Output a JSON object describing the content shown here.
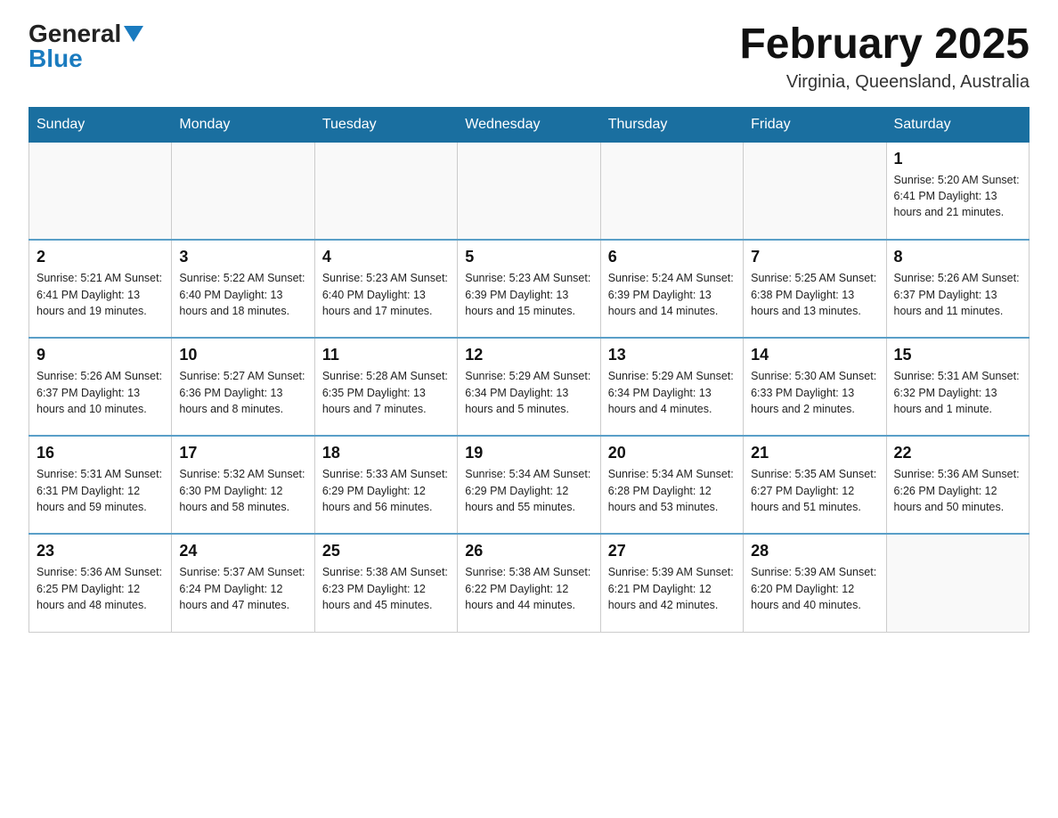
{
  "header": {
    "logo_general": "General",
    "logo_blue": "Blue",
    "month_year": "February 2025",
    "location": "Virginia, Queensland, Australia"
  },
  "weekdays": [
    "Sunday",
    "Monday",
    "Tuesday",
    "Wednesday",
    "Thursday",
    "Friday",
    "Saturday"
  ],
  "weeks": [
    [
      {
        "day": "",
        "info": ""
      },
      {
        "day": "",
        "info": ""
      },
      {
        "day": "",
        "info": ""
      },
      {
        "day": "",
        "info": ""
      },
      {
        "day": "",
        "info": ""
      },
      {
        "day": "",
        "info": ""
      },
      {
        "day": "1",
        "info": "Sunrise: 5:20 AM\nSunset: 6:41 PM\nDaylight: 13 hours and 21 minutes."
      }
    ],
    [
      {
        "day": "2",
        "info": "Sunrise: 5:21 AM\nSunset: 6:41 PM\nDaylight: 13 hours and 19 minutes."
      },
      {
        "day": "3",
        "info": "Sunrise: 5:22 AM\nSunset: 6:40 PM\nDaylight: 13 hours and 18 minutes."
      },
      {
        "day": "4",
        "info": "Sunrise: 5:23 AM\nSunset: 6:40 PM\nDaylight: 13 hours and 17 minutes."
      },
      {
        "day": "5",
        "info": "Sunrise: 5:23 AM\nSunset: 6:39 PM\nDaylight: 13 hours and 15 minutes."
      },
      {
        "day": "6",
        "info": "Sunrise: 5:24 AM\nSunset: 6:39 PM\nDaylight: 13 hours and 14 minutes."
      },
      {
        "day": "7",
        "info": "Sunrise: 5:25 AM\nSunset: 6:38 PM\nDaylight: 13 hours and 13 minutes."
      },
      {
        "day": "8",
        "info": "Sunrise: 5:26 AM\nSunset: 6:37 PM\nDaylight: 13 hours and 11 minutes."
      }
    ],
    [
      {
        "day": "9",
        "info": "Sunrise: 5:26 AM\nSunset: 6:37 PM\nDaylight: 13 hours and 10 minutes."
      },
      {
        "day": "10",
        "info": "Sunrise: 5:27 AM\nSunset: 6:36 PM\nDaylight: 13 hours and 8 minutes."
      },
      {
        "day": "11",
        "info": "Sunrise: 5:28 AM\nSunset: 6:35 PM\nDaylight: 13 hours and 7 minutes."
      },
      {
        "day": "12",
        "info": "Sunrise: 5:29 AM\nSunset: 6:34 PM\nDaylight: 13 hours and 5 minutes."
      },
      {
        "day": "13",
        "info": "Sunrise: 5:29 AM\nSunset: 6:34 PM\nDaylight: 13 hours and 4 minutes."
      },
      {
        "day": "14",
        "info": "Sunrise: 5:30 AM\nSunset: 6:33 PM\nDaylight: 13 hours and 2 minutes."
      },
      {
        "day": "15",
        "info": "Sunrise: 5:31 AM\nSunset: 6:32 PM\nDaylight: 13 hours and 1 minute."
      }
    ],
    [
      {
        "day": "16",
        "info": "Sunrise: 5:31 AM\nSunset: 6:31 PM\nDaylight: 12 hours and 59 minutes."
      },
      {
        "day": "17",
        "info": "Sunrise: 5:32 AM\nSunset: 6:30 PM\nDaylight: 12 hours and 58 minutes."
      },
      {
        "day": "18",
        "info": "Sunrise: 5:33 AM\nSunset: 6:29 PM\nDaylight: 12 hours and 56 minutes."
      },
      {
        "day": "19",
        "info": "Sunrise: 5:34 AM\nSunset: 6:29 PM\nDaylight: 12 hours and 55 minutes."
      },
      {
        "day": "20",
        "info": "Sunrise: 5:34 AM\nSunset: 6:28 PM\nDaylight: 12 hours and 53 minutes."
      },
      {
        "day": "21",
        "info": "Sunrise: 5:35 AM\nSunset: 6:27 PM\nDaylight: 12 hours and 51 minutes."
      },
      {
        "day": "22",
        "info": "Sunrise: 5:36 AM\nSunset: 6:26 PM\nDaylight: 12 hours and 50 minutes."
      }
    ],
    [
      {
        "day": "23",
        "info": "Sunrise: 5:36 AM\nSunset: 6:25 PM\nDaylight: 12 hours and 48 minutes."
      },
      {
        "day": "24",
        "info": "Sunrise: 5:37 AM\nSunset: 6:24 PM\nDaylight: 12 hours and 47 minutes."
      },
      {
        "day": "25",
        "info": "Sunrise: 5:38 AM\nSunset: 6:23 PM\nDaylight: 12 hours and 45 minutes."
      },
      {
        "day": "26",
        "info": "Sunrise: 5:38 AM\nSunset: 6:22 PM\nDaylight: 12 hours and 44 minutes."
      },
      {
        "day": "27",
        "info": "Sunrise: 5:39 AM\nSunset: 6:21 PM\nDaylight: 12 hours and 42 minutes."
      },
      {
        "day": "28",
        "info": "Sunrise: 5:39 AM\nSunset: 6:20 PM\nDaylight: 12 hours and 40 minutes."
      },
      {
        "day": "",
        "info": ""
      }
    ]
  ]
}
